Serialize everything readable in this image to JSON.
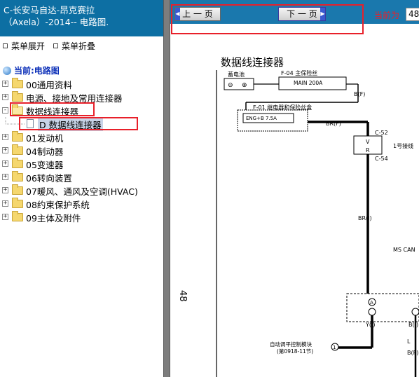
{
  "left_panel": {
    "title": "C-长安马自达-昂克赛拉（Axela）-2014-- 电路图.",
    "expand_all": "菜单展开",
    "collapse_all": "菜单折叠",
    "current": "当前:电路图",
    "tree": [
      {
        "label": "00通用资料",
        "state": "+"
      },
      {
        "label": "电源、接地及常用连接器",
        "state": "+"
      },
      {
        "label": "数据线连接器",
        "state": "-"
      },
      {
        "label": "D 数据线连接器",
        "state": "leaf"
      },
      {
        "label": "01发动机",
        "state": "+"
      },
      {
        "label": "04制动器",
        "state": "+"
      },
      {
        "label": "05变速器",
        "state": "+"
      },
      {
        "label": "06转向装置",
        "state": "+"
      },
      {
        "label": "07暖风、通风及空调(HVAC)",
        "state": "+"
      },
      {
        "label": "08约束保护系统",
        "state": "+"
      },
      {
        "label": "09主体及附件",
        "state": "+"
      }
    ]
  },
  "nav": {
    "prev": "上 一 页",
    "next": "下 一 页",
    "page_label": "当前为",
    "page_value": "48"
  },
  "diagram": {
    "title": "数据线连接器",
    "page_number": "48",
    "battery": "蓄电池",
    "fuse_main_label": "F-04  主保险丝",
    "fuse_main": "MAIN 200A",
    "bf1": "B(F)",
    "fuse_box_label": "F-01  继电器和保险丝盒",
    "fuse_eng": "ENG+B 7.5A",
    "brf": "BR(F)",
    "c52": "C-52",
    "c54": "C-54",
    "v": "V",
    "r": "R",
    "junction": "1号接线",
    "bri": "BR(I)",
    "ms_can": "MS CAN",
    "yi": "Y(I)",
    "bi": "B(I)",
    "module_line1": "自动调平控制模块",
    "module_line2": "(第0918-11节)",
    "l": "L",
    "bf2": "B(F)",
    "circle_a": "A",
    "circle_1": "1"
  },
  "colors": {
    "title_bar": "#0d6fa3",
    "nav_bar": "#1a78ad",
    "highlight": "#e8202a",
    "current_text": "#0a2eb8"
  }
}
